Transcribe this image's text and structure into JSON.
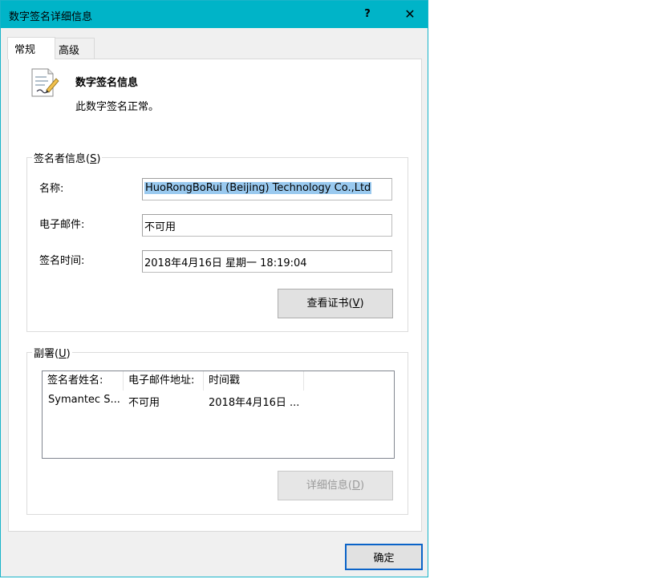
{
  "window": {
    "title": "数字签名详细信息",
    "help_glyph": "?",
    "close_glyph": "✕"
  },
  "tabs": [
    {
      "label": "常规",
      "active": true
    },
    {
      "label": "高级",
      "active": false
    }
  ],
  "info": {
    "heading": "数字签名信息",
    "status": "此数字签名正常。",
    "icon": "certificate-icon"
  },
  "signer": {
    "group_label": "签名者信息",
    "group_key": "S",
    "name_label": "名称:",
    "name_value": "HuoRongBoRui (Beijing) Technology Co.,Ltd",
    "email_label": "电子邮件:",
    "email_value": "不可用",
    "time_label": "签名时间:",
    "time_value": "2018年4月16日 星期一 18:19:04",
    "view_cert_label": "查看证书",
    "view_cert_key": "V"
  },
  "countersig": {
    "group_label": "副署",
    "group_key": "U",
    "columns": [
      "签名者姓名:",
      "电子邮件地址:",
      "时间戳"
    ],
    "rows": [
      [
        "Symantec S...",
        "不可用",
        "2018年4月16日 ..."
      ]
    ],
    "details_label": "详细信息",
    "details_key": "D"
  },
  "footer": {
    "ok_label": "确定"
  },
  "colors": {
    "titlebar": "#00b4c8",
    "selection": "#99c9ef",
    "default_button_border": "#0a63c8"
  }
}
